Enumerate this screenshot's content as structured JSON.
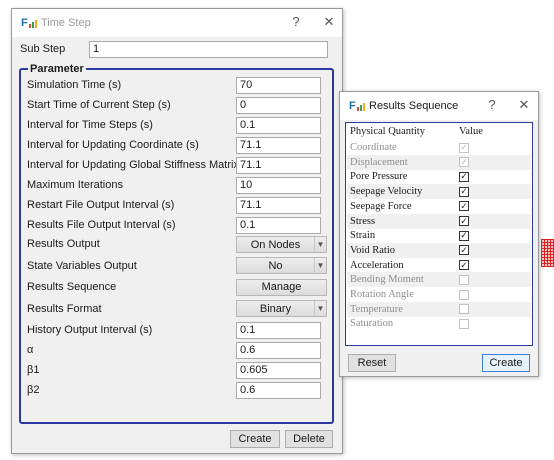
{
  "time_step_window": {
    "title": "Time Step",
    "help_glyph": "?",
    "close_glyph": "✕",
    "sub_step_label": "Sub Step",
    "sub_step_value": "1",
    "group_title": "Parameter",
    "fields": [
      {
        "label": "Simulation Time (s)",
        "value": "70"
      },
      {
        "label": "Start Time of Current Step (s)",
        "value": "0"
      },
      {
        "label": "Interval for Time Steps (s)",
        "value": "0.1"
      },
      {
        "label": "Interval for Updating Coordinate (s)",
        "value": "71.1"
      },
      {
        "label": "Interval for Updating Global Stiffness Matrix (s)",
        "value": "71.1"
      },
      {
        "label": "Maximum Iterations",
        "value": "10"
      },
      {
        "label": "Restart File Output Interval (s)",
        "value": "71.1"
      },
      {
        "label": "Results File Output Interval (s)",
        "value": "0.1"
      }
    ],
    "results_output": {
      "label": "Results Output",
      "value": "On Nodes"
    },
    "state_variables_output": {
      "label": "State Variables Output",
      "value": "No"
    },
    "results_sequence": {
      "label": "Results Sequence",
      "button": "Manage"
    },
    "results_format": {
      "label": "Results Format",
      "value": "Binary"
    },
    "fields2": [
      {
        "label": "History Output Interval (s)",
        "value": "0.1"
      },
      {
        "label": "α",
        "value": "0.6"
      },
      {
        "label": "β1",
        "value": "0.605"
      },
      {
        "label": "β2",
        "value": "0.6"
      }
    ],
    "create_button": "Create",
    "delete_button": "Delete"
  },
  "results_sequence_window": {
    "title": "Results Sequence",
    "help_glyph": "?",
    "close_glyph": "✕",
    "header_quantity": "Physical Quantity",
    "header_value": "Value",
    "rows": [
      {
        "name": "Coordinate",
        "checked": true,
        "enabled": false
      },
      {
        "name": "Displacement",
        "checked": true,
        "enabled": false
      },
      {
        "name": "Pore Pressure",
        "checked": true,
        "enabled": true
      },
      {
        "name": "Seepage Velocity",
        "checked": true,
        "enabled": true
      },
      {
        "name": "Seepage Force",
        "checked": true,
        "enabled": true
      },
      {
        "name": "Stress",
        "checked": true,
        "enabled": true
      },
      {
        "name": "Strain",
        "checked": true,
        "enabled": true
      },
      {
        "name": "Void Ratio",
        "checked": true,
        "enabled": true
      },
      {
        "name": "Acceleration",
        "checked": true,
        "enabled": true
      },
      {
        "name": "Bending Moment",
        "checked": false,
        "enabled": false
      },
      {
        "name": "Rotation Angle",
        "checked": false,
        "enabled": false
      },
      {
        "name": "Temperature",
        "checked": false,
        "enabled": false
      },
      {
        "name": "Saturation",
        "checked": false,
        "enabled": false
      }
    ],
    "reset_button": "Reset",
    "create_button": "Create"
  },
  "icons": {
    "app": "fe-app-icon",
    "dropdown": "chevron-down-icon",
    "check": "check-icon"
  },
  "colors": {
    "group_border": "#2a3aa0",
    "default_button_border": "#3c7fd4"
  }
}
